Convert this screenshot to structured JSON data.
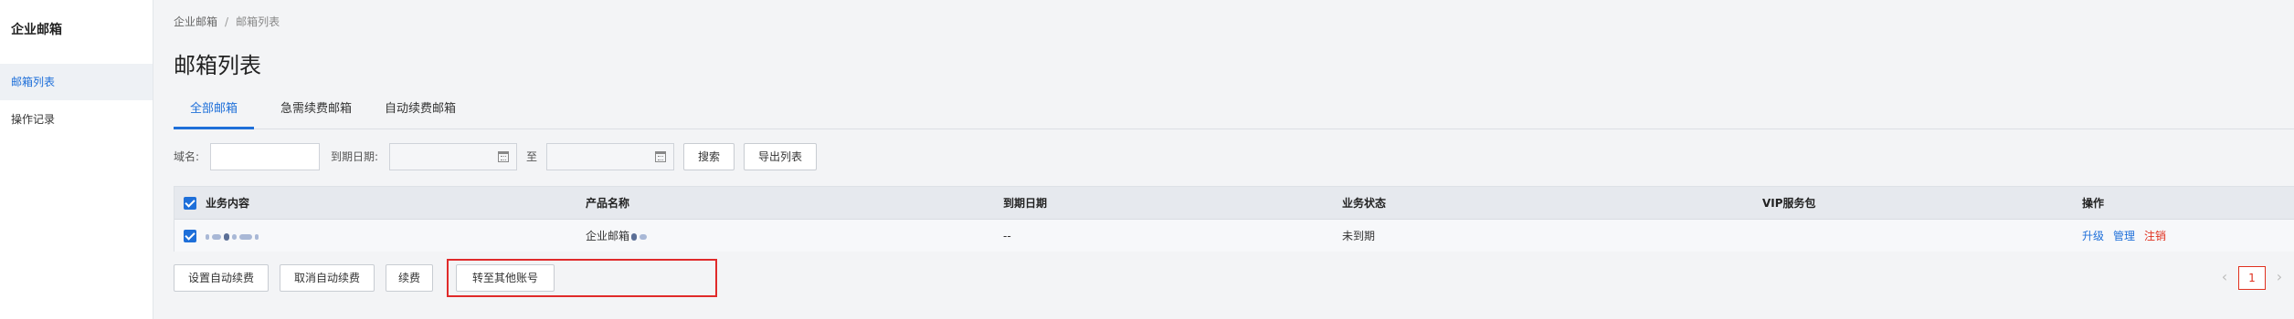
{
  "sidebar": {
    "title": "企业邮箱",
    "items": [
      {
        "label": "邮箱列表",
        "active": true
      },
      {
        "label": "操作记录",
        "active": false
      }
    ]
  },
  "breadcrumb": {
    "root": "企业邮箱",
    "separator": "/",
    "current": "邮箱列表"
  },
  "page": {
    "title": "邮箱列表"
  },
  "tabs": [
    {
      "label": "全部邮箱",
      "active": true
    },
    {
      "label": "急需续费邮箱",
      "active": false
    },
    {
      "label": "自动续费邮箱",
      "active": false
    }
  ],
  "filter": {
    "domain_label": "域名:",
    "domain_value": "",
    "expire_label": "到期日期:",
    "date_from": "",
    "to_label": "至",
    "date_to": "",
    "search_button": "搜索",
    "export_button": "导出列表"
  },
  "table": {
    "columns": [
      "业务内容",
      "产品名称",
      "到期日期",
      "业务状态",
      "VIP服务包",
      "操作"
    ],
    "header_checked": true,
    "rows": [
      {
        "checked": true,
        "content": "",
        "product": "企业邮箱",
        "expire": "--",
        "status": "未到期",
        "vip": "",
        "actions": [
          "升级",
          "管理",
          "注销"
        ]
      }
    ]
  },
  "bulk_actions": {
    "set_auto_renew": "设置自动续费",
    "cancel_auto_renew": "取消自动续费",
    "renew": "续费",
    "transfer": "转至其他账号"
  },
  "pagination": {
    "prev": "‹",
    "current_page": "1",
    "next": "›"
  },
  "colors": {
    "accent": "#1e6fd9",
    "danger": "#e0301e",
    "highlight_box": "#e02a2a",
    "header_bg": "#e6e9ee"
  }
}
